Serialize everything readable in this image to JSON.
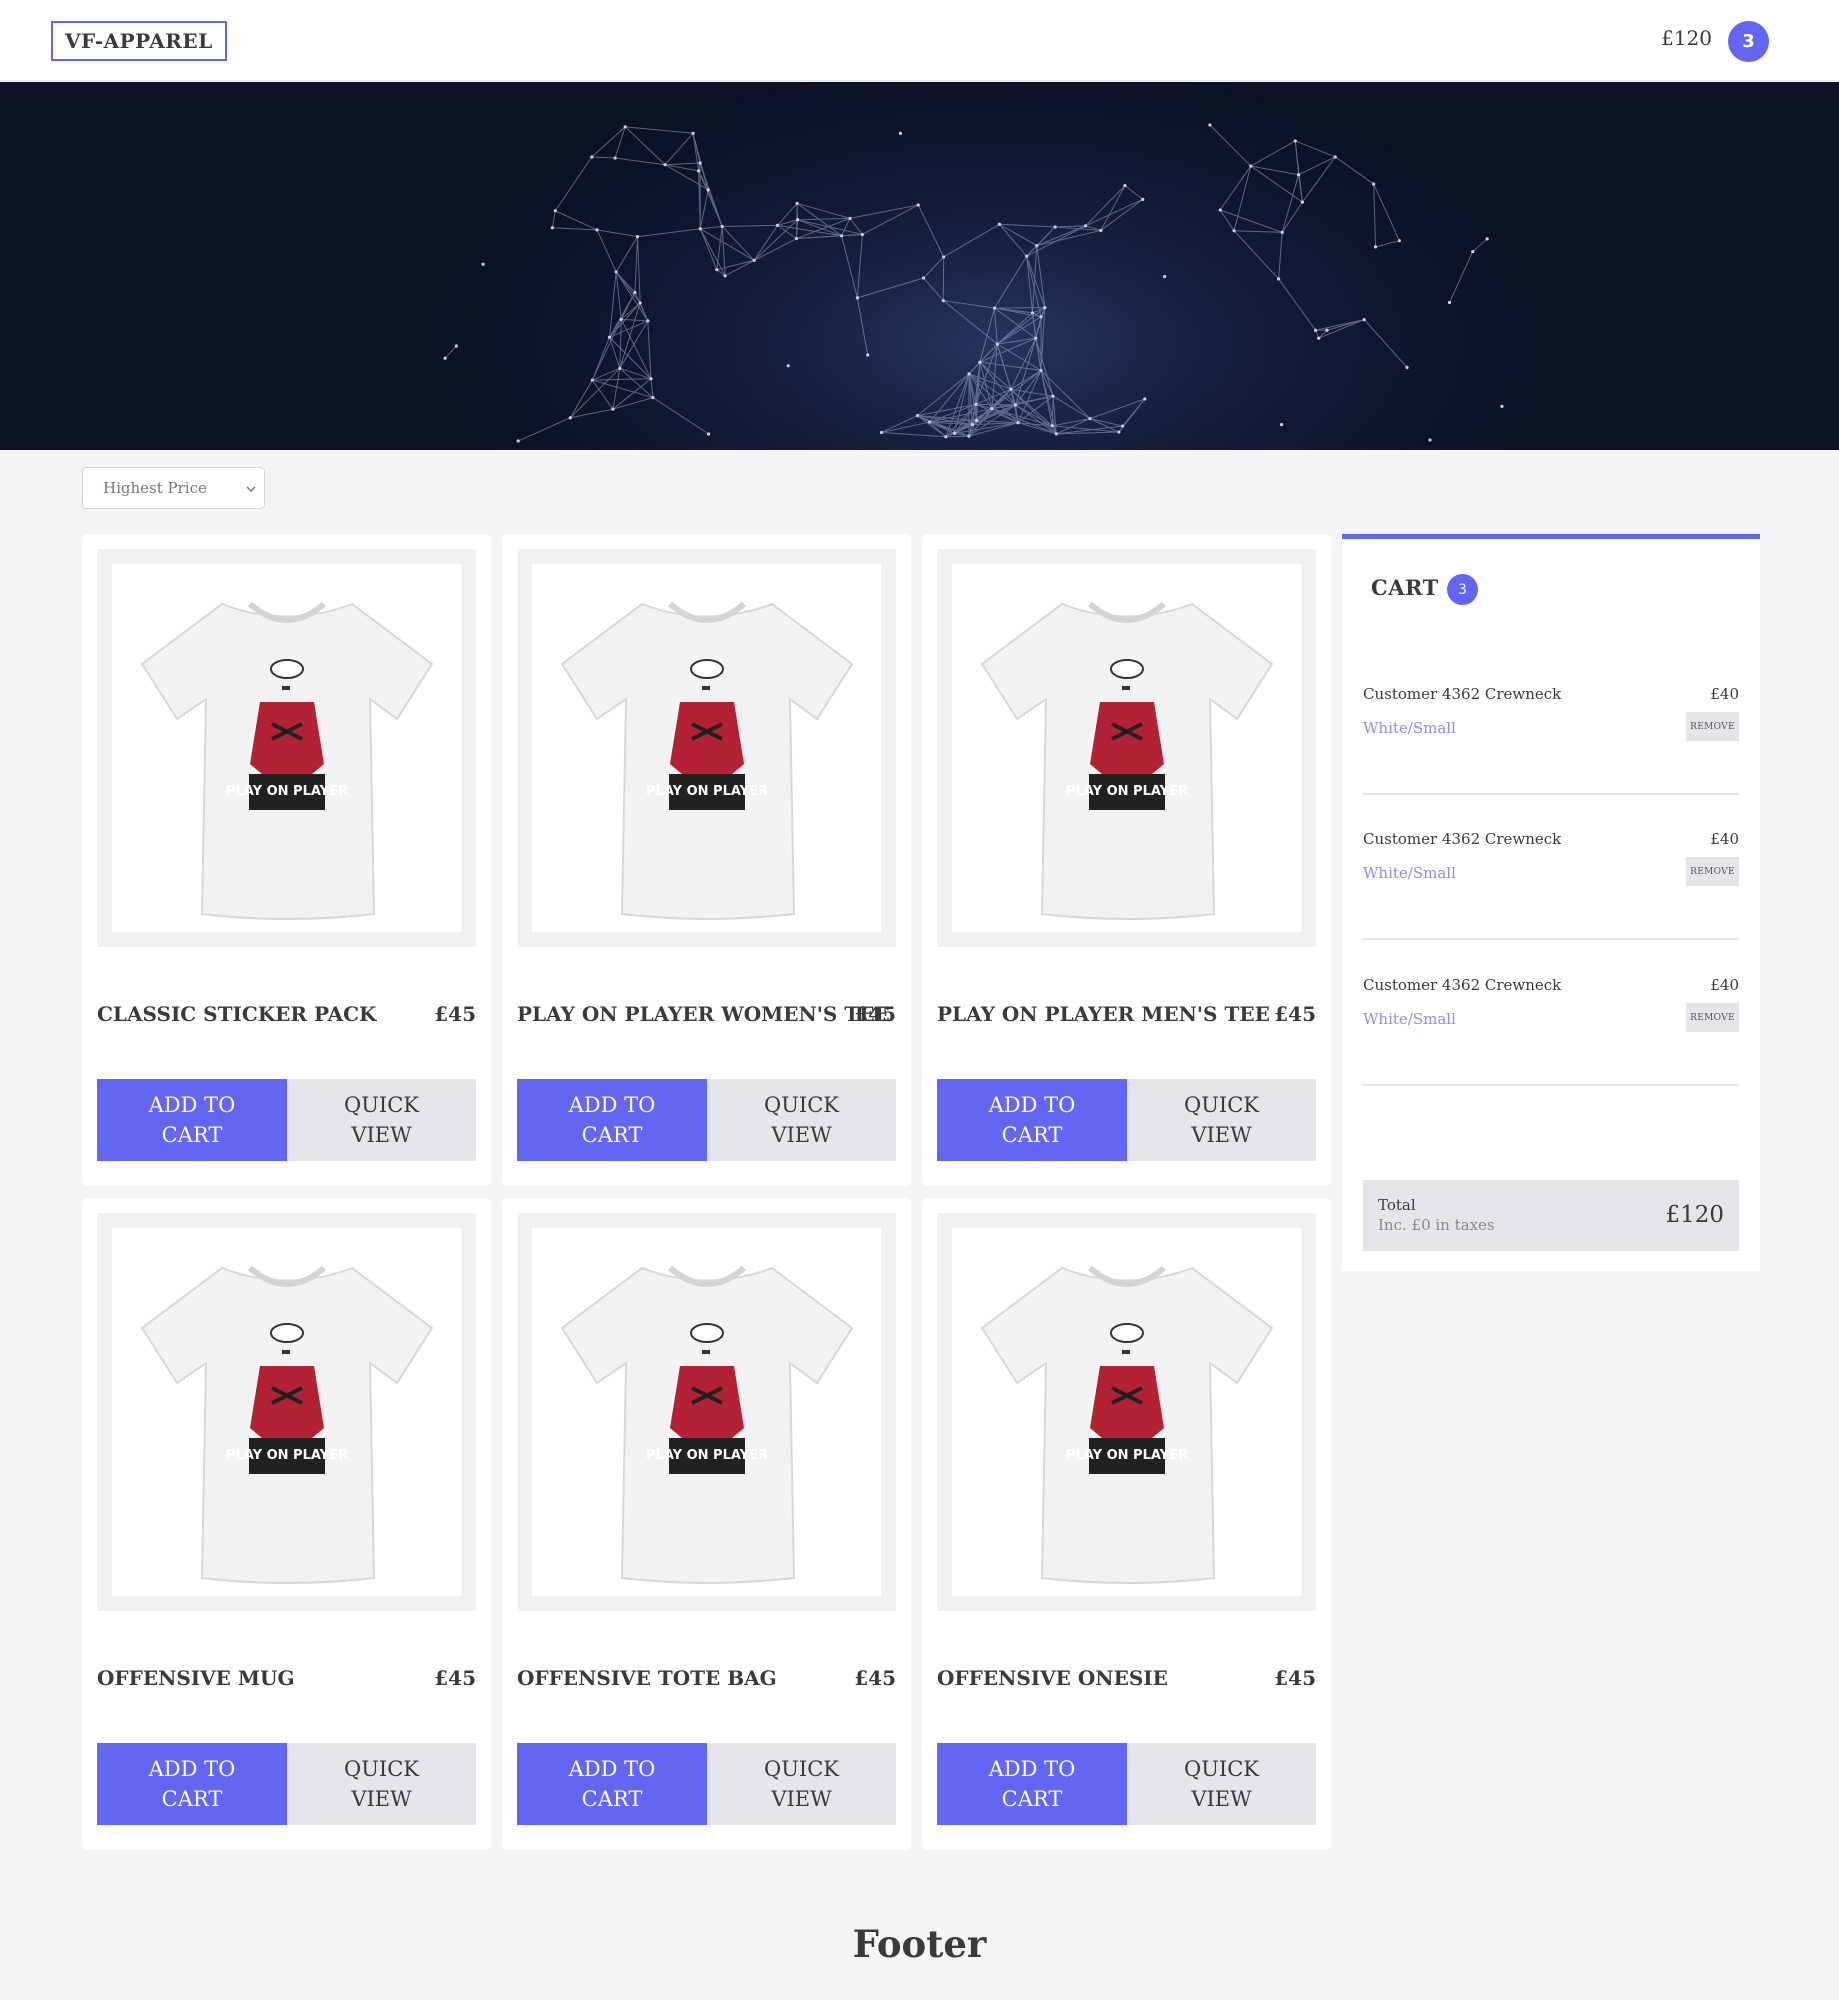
{
  "header": {
    "logo": "VF-APPAREL",
    "cart_total": "£120",
    "cart_count": "3"
  },
  "sort": {
    "selected": "Highest Price"
  },
  "products": [
    {
      "title": "CLASSIC STICKER PACK",
      "price": "£45",
      "add_label": "ADD TO CART",
      "quick_label": "QUICK VIEW",
      "shirt_text": "PLAY ON PLAYER"
    },
    {
      "title": "PLAY ON PLAYER WOMEN'S TEE",
      "price": "£45",
      "add_label": "ADD TO CART",
      "quick_label": "QUICK VIEW",
      "shirt_text": "PLAY ON PLAYER"
    },
    {
      "title": "PLAY ON PLAYER MEN'S TEE",
      "price": "£45",
      "add_label": "ADD TO CART",
      "quick_label": "QUICK VIEW",
      "shirt_text": "PLAY ON PLAYER"
    },
    {
      "title": "OFFENSIVE MUG",
      "price": "£45",
      "add_label": "ADD TO CART",
      "quick_label": "QUICK VIEW",
      "shirt_text": "PLAY ON PLAYER"
    },
    {
      "title": "OFFENSIVE TOTE BAG",
      "price": "£45",
      "add_label": "ADD TO CART",
      "quick_label": "QUICK VIEW",
      "shirt_text": "PLAY ON PLAYER"
    },
    {
      "title": "OFFENSIVE ONESIE",
      "price": "£45",
      "add_label": "ADD TO CART",
      "quick_label": "QUICK VIEW",
      "shirt_text": "PLAY ON PLAYER"
    }
  ],
  "cart": {
    "title": "CART",
    "count": "3",
    "items": [
      {
        "name": "Customer 4362 Crewneck",
        "price": "£40",
        "variant": "White/Small",
        "remove_label": "REMOVE"
      },
      {
        "name": "Customer 4362 Crewneck",
        "price": "£40",
        "variant": "White/Small",
        "remove_label": "REMOVE"
      },
      {
        "name": "Customer 4362 Crewneck",
        "price": "£40",
        "variant": "White/Small",
        "remove_label": "REMOVE"
      }
    ],
    "total_label": "Total",
    "total_sub": "Inc. £0 in taxes",
    "total_value": "£120"
  },
  "footer": {
    "text": "Footer"
  },
  "colors": {
    "accent": "#6366f1",
    "variant_text": "#8c8ef5",
    "button_secondary": "#e5e4e8",
    "page_bg": "#f4f3f6"
  },
  "icons": {
    "sort_dropdown": "chevron-down-icon",
    "product_image": "tshirt-icon"
  }
}
